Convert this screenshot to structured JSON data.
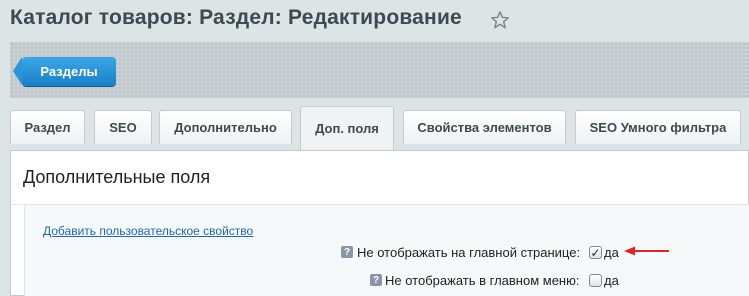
{
  "page": {
    "title": "Каталог товаров: Раздел: Редактирование",
    "star_icon": "star-outline-icon"
  },
  "toolbar": {
    "back_label": "Разделы"
  },
  "tabs": [
    {
      "label": "Раздел"
    },
    {
      "label": "SEO"
    },
    {
      "label": "Дополнительно"
    },
    {
      "label": "Доп. поля",
      "active": true
    },
    {
      "label": "Свойства элементов"
    },
    {
      "label": "SEO Умного фильтра"
    }
  ],
  "section": {
    "heading": "Дополнительные поля",
    "add_property_link": "Добавить пользовательское свойство",
    "fields": [
      {
        "label": "Не отображать на главной странице:",
        "value_label": "да",
        "checked": true
      },
      {
        "label": "Не отображать в главном меню:",
        "value_label": "да",
        "checked": false
      }
    ]
  },
  "colors": {
    "accent_button": "#1a7fc7",
    "link": "#2067b0",
    "annotation_arrow": "#e2232a"
  }
}
